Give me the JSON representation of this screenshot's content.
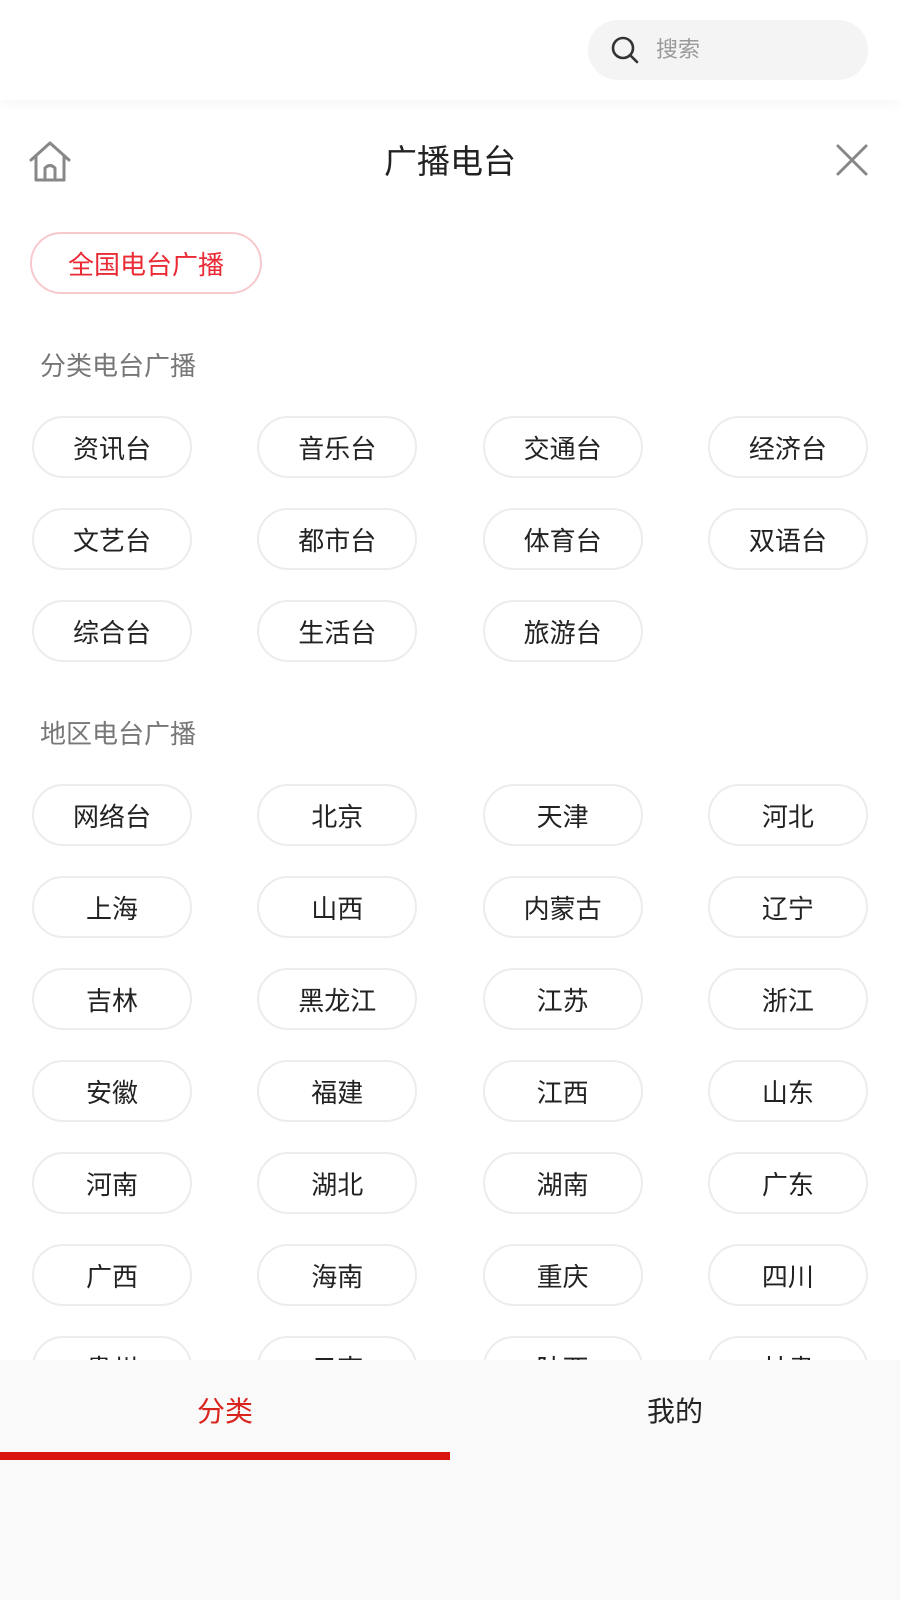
{
  "search": {
    "placeholder": "搜索"
  },
  "header": {
    "title": "广播电台"
  },
  "national": {
    "label": "全国电台广播"
  },
  "sections": {
    "category": {
      "title": "分类电台广播",
      "items": [
        "资讯台",
        "音乐台",
        "交通台",
        "经济台",
        "文艺台",
        "都市台",
        "体育台",
        "双语台",
        "综合台",
        "生活台",
        "旅游台"
      ]
    },
    "region": {
      "title": "地区电台广播",
      "items": [
        "网络台",
        "北京",
        "天津",
        "河北",
        "上海",
        "山西",
        "内蒙古",
        "辽宁",
        "吉林",
        "黑龙江",
        "江苏",
        "浙江",
        "安徽",
        "福建",
        "江西",
        "山东",
        "河南",
        "湖北",
        "湖南",
        "广东",
        "广西",
        "海南",
        "重庆",
        "四川",
        "贵州",
        "云南",
        "陕西",
        "甘肃"
      ]
    }
  },
  "bottom_nav": {
    "tabs": [
      {
        "label": "分类",
        "active": true
      },
      {
        "label": "我的",
        "active": false
      }
    ]
  },
  "colors": {
    "accent": "#d9231d",
    "accent_light_border": "#f7c9cc",
    "pill_border": "#ececec",
    "section_title": "#777777"
  },
  "icons": {
    "search": "search-icon",
    "home": "home-icon",
    "close": "close-icon"
  }
}
